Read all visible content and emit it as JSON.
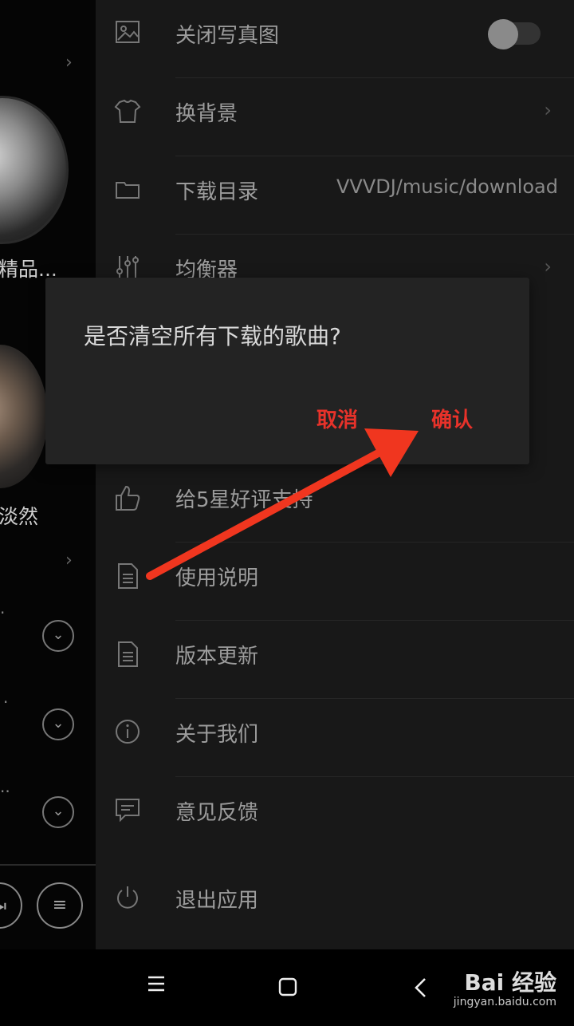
{
  "background": {
    "album1_caption": "精品...",
    "album2_caption": "淡然"
  },
  "menu": [
    {
      "id": "close-photo",
      "label": "关闭写真图",
      "icon": "image-icon",
      "control": "toggle",
      "toggle_on": false
    },
    {
      "id": "change-background",
      "label": "换背景",
      "icon": "tshirt-icon",
      "control": "chevron"
    },
    {
      "id": "download-dir",
      "label": "下载目录",
      "icon": "folder-icon",
      "control": "value",
      "value": "VVVDJ/music/download"
    },
    {
      "id": "equalizer",
      "label": "均衡器",
      "icon": "equalizer-icon",
      "control": "chevron"
    },
    {
      "id": "rate-5-stars",
      "label": "给5星好评支持",
      "icon": "thumbs-up-icon"
    },
    {
      "id": "instructions",
      "label": "使用说明",
      "icon": "document-icon"
    },
    {
      "id": "version-update",
      "label": "版本更新",
      "icon": "document-icon"
    },
    {
      "id": "about-us",
      "label": "关于我们",
      "icon": "info-icon"
    },
    {
      "id": "feedback",
      "label": "意见反馈",
      "icon": "message-icon"
    },
    {
      "id": "exit-app",
      "label": "退出应用",
      "icon": "power-icon"
    }
  ],
  "dialog": {
    "message": "是否清空所有下载的歌曲?",
    "cancel": "取消",
    "confirm": "确认"
  },
  "colors": {
    "accent": "#e8322a",
    "drawer_bg": "#181818",
    "dialog_bg": "#232323"
  },
  "watermark": {
    "title": "Bai 经验",
    "subtitle": "jingyan.baidu.com"
  }
}
